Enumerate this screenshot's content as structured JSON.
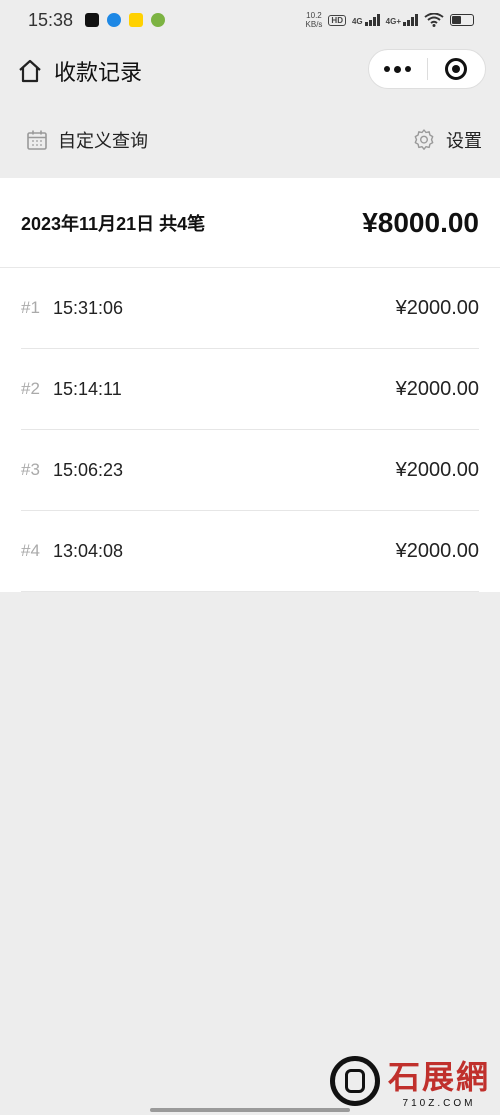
{
  "status_bar": {
    "time": "15:38",
    "net_speed_value": "10.2",
    "net_speed_unit": "KB/s",
    "hd_label": "HD",
    "network_1": "4G",
    "network_2": "4G+",
    "app_icons": [
      "capcut-icon",
      "browser-icon",
      "meituan-icon",
      "app-icon"
    ]
  },
  "nav": {
    "title": "收款记录"
  },
  "filter": {
    "custom_query_label": "自定义查询",
    "settings_label": "设置"
  },
  "summary": {
    "date_count": "2023年11月21日 共4笔",
    "total": "¥8000.00"
  },
  "records": [
    {
      "index": "#1",
      "time": "15:31:06",
      "amount": "¥2000.00"
    },
    {
      "index": "#2",
      "time": "15:14:11",
      "amount": "¥2000.00"
    },
    {
      "index": "#3",
      "time": "15:06:23",
      "amount": "¥2000.00"
    },
    {
      "index": "#4",
      "time": "13:04:08",
      "amount": "¥2000.00"
    }
  ],
  "watermark": {
    "text": "石展網",
    "domain": "710Z.COM"
  },
  "colors": {
    "background": "#ededed",
    "card": "#ffffff",
    "watermark_red": "#c0302c"
  }
}
